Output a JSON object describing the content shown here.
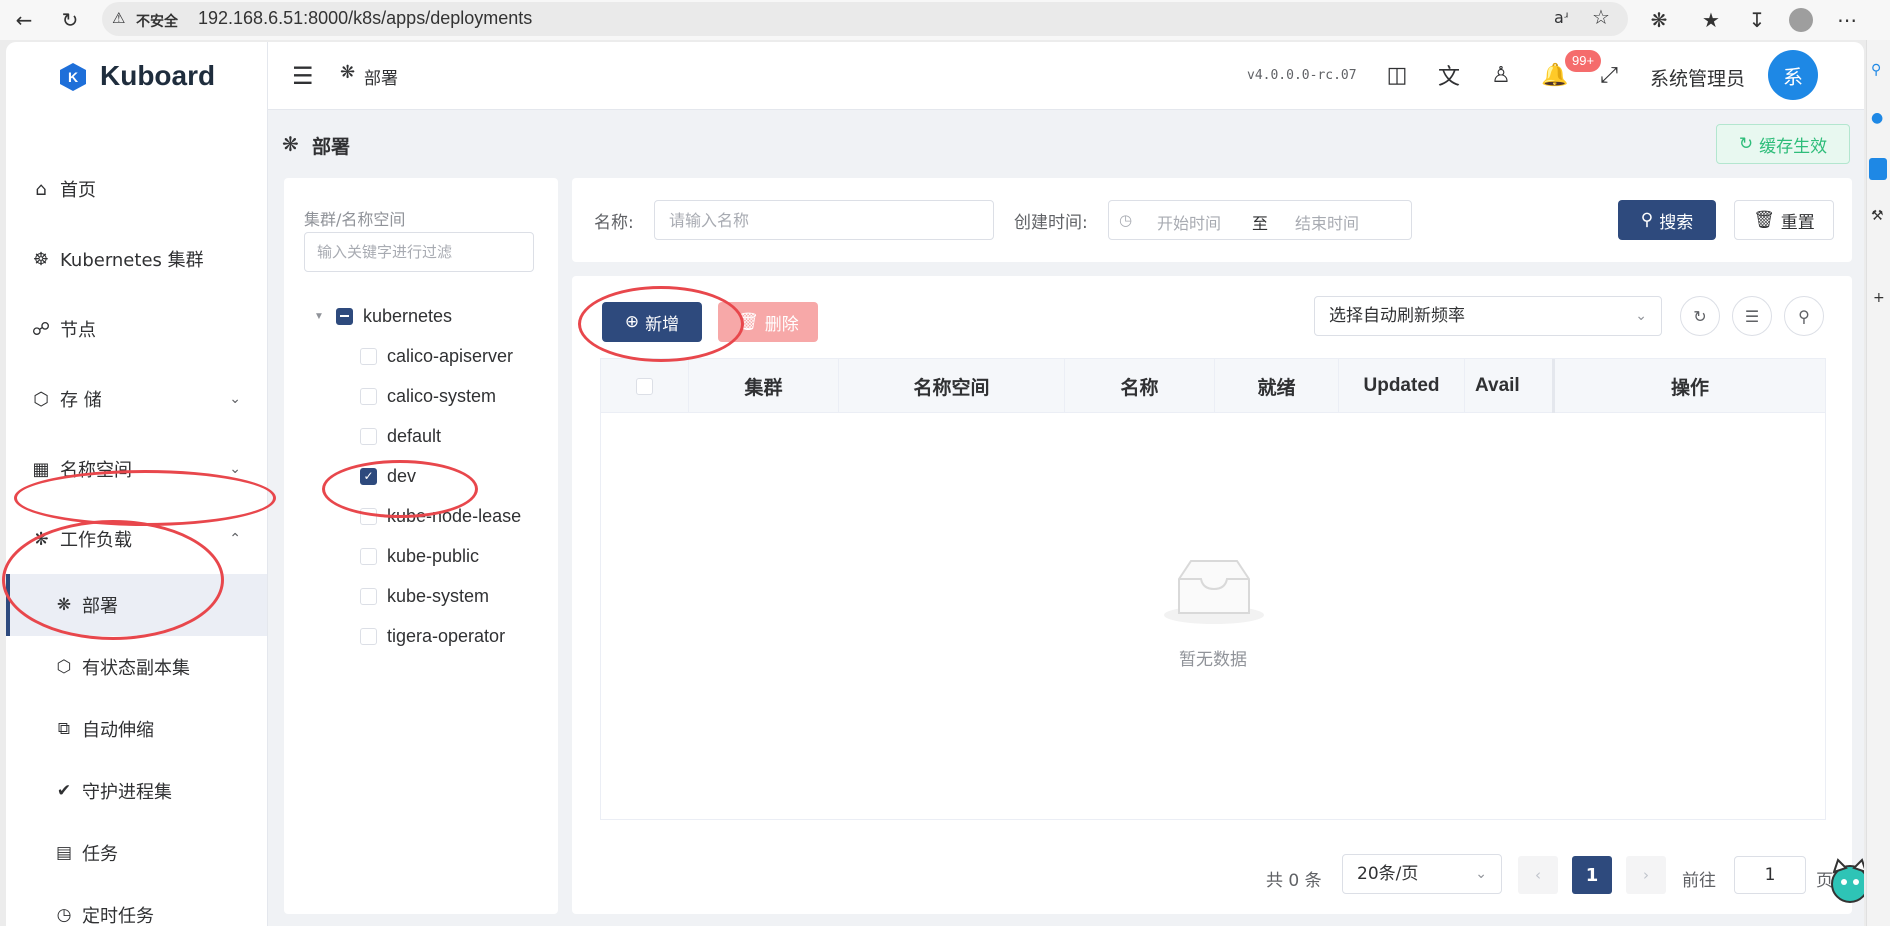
{
  "browser": {
    "insecure_label": "不安全",
    "url": "192.168.6.51:8000/k8s/apps/deployments"
  },
  "sidebar": {
    "brand": "Kuboard",
    "items": [
      {
        "label": "首页",
        "icon": "home-icon"
      },
      {
        "label": "Kubernetes 集群",
        "icon": "helm-icon"
      },
      {
        "label": "节点",
        "icon": "nodes-icon"
      },
      {
        "label": "存 储",
        "icon": "storage-icon"
      },
      {
        "label": "名称空间",
        "icon": "namespace-icon"
      },
      {
        "label": "工作负载",
        "icon": "workload-icon"
      }
    ],
    "sub_items": [
      {
        "label": "部署",
        "icon": "deployment-icon",
        "active": true
      },
      {
        "label": "有状态副本集",
        "icon": "statefulset-icon"
      },
      {
        "label": "自动伸缩",
        "icon": "autoscale-icon"
      },
      {
        "label": "守护进程集",
        "icon": "daemonset-icon"
      },
      {
        "label": "任务",
        "icon": "job-icon"
      },
      {
        "label": "定时任务",
        "icon": "cronjob-icon"
      }
    ]
  },
  "header": {
    "breadcrumb": "部署",
    "version": "v4.0.0.0-rc.07",
    "notification_badge": "99+",
    "user_name": "系统管理员",
    "avatar_text": "系"
  },
  "page": {
    "title": "部署",
    "refresh_cache_label": "缓存生效"
  },
  "tree": {
    "title": "集群/名称空间",
    "filter_placeholder": "输入关键字进行过滤",
    "root": "kubernetes",
    "namespaces": [
      {
        "name": "calico-apiserver",
        "checked": false
      },
      {
        "name": "calico-system",
        "checked": false
      },
      {
        "name": "default",
        "checked": false
      },
      {
        "name": "dev",
        "checked": true
      },
      {
        "name": "kube-node-lease",
        "checked": false
      },
      {
        "name": "kube-public",
        "checked": false
      },
      {
        "name": "kube-system",
        "checked": false
      },
      {
        "name": "tigera-operator",
        "checked": false
      }
    ]
  },
  "filters": {
    "name_label": "名称:",
    "name_placeholder": "请输入名称",
    "created_label": "创建时间:",
    "start_placeholder": "开始时间",
    "separator": "至",
    "end_placeholder": "结束时间",
    "search_label": "搜索",
    "reset_label": "重置"
  },
  "table": {
    "add_label": "新增",
    "delete_label": "删除",
    "refresh_placeholder": "选择自动刷新频率",
    "columns": [
      "集群",
      "名称空间",
      "名称",
      "就绪",
      "Updated",
      "Avail",
      "操作"
    ],
    "empty_text": "暂无数据"
  },
  "pagination": {
    "total": "共 0 条",
    "page_size": "20条/页",
    "current_page": "1",
    "goto_label": "前往",
    "goto_value": "1",
    "goto_suffix": "页"
  },
  "colors": {
    "primary": "#2e4a7d",
    "danger_light": "#f7a8a8",
    "success": "#2ebd7a",
    "annotation_red": "#e8474c"
  }
}
